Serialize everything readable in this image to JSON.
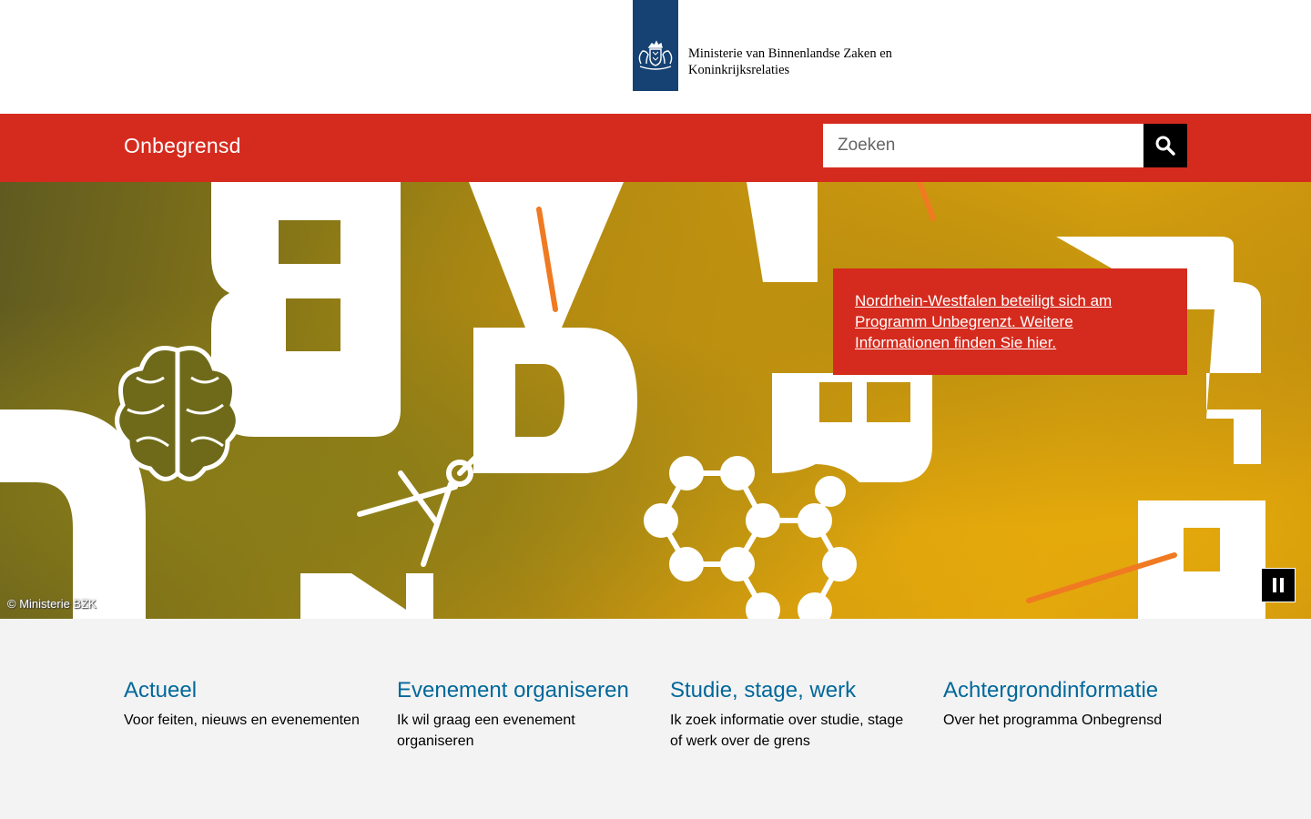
{
  "header": {
    "ministry_line1": "Ministerie van Binnenlandse Zaken en",
    "ministry_line2": "Koninkrijksrelaties",
    "logo_icon": "rijkswapen-emblem-icon",
    "logo_color": "#154273"
  },
  "brand_bar": {
    "title": "Onbegrensd",
    "color": "#d52b1e",
    "search": {
      "placeholder": "Zoeken",
      "value": "",
      "button_icon": "search-icon"
    }
  },
  "hero": {
    "notice_text": "Nordrhein-Westfalen beteiligt sich am Programm Unbegrenzt. Weitere Informationen finden Sie hier.",
    "copyright": "© Ministerie BZK",
    "pause_icon": "pause-icon"
  },
  "tiles": [
    {
      "title": "Actueel",
      "description": "Voor feiten, nieuws en evenementen"
    },
    {
      "title": "Evenement organiseren",
      "description": "Ik wil graag een evenement organiseren"
    },
    {
      "title": "Studie, stage, werk",
      "description": "Ik zoek informatie over studie, stage of werk over de grens"
    },
    {
      "title": "Achtergrondinformatie",
      "description": "Over het programma Onbegrensd"
    }
  ],
  "colors": {
    "link": "#01689b",
    "accent": "#d52b1e",
    "background": "#f3f3f3"
  }
}
